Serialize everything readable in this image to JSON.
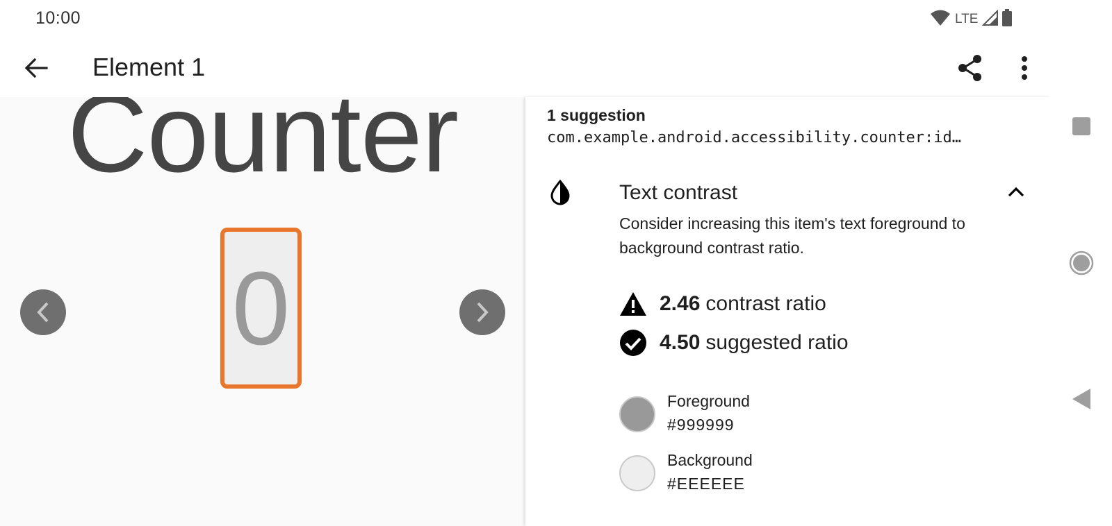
{
  "status_bar": {
    "time": "10:00",
    "network": "LTE",
    "icons": [
      "wifi-icon",
      "cell-signal-icon",
      "battery-icon"
    ]
  },
  "app_bar": {
    "title": "Element 1",
    "icons": [
      "back-arrow-icon",
      "share-icon",
      "more-vert-icon"
    ]
  },
  "screenshot": {
    "app_title": "Counter",
    "counter_value": "0",
    "highlight_color": "#E8762D",
    "buttons": [
      "chevron-left-icon",
      "chevron-right-icon"
    ]
  },
  "panel": {
    "suggestion_count": "1 suggestion",
    "element_id": "com.example.android.accessibility.counter:id…",
    "check": {
      "icon": "contrast-icon",
      "title": "Text contrast",
      "description": "Consider increasing this item's text foreground to background contrast ratio.",
      "collapse_icon": "chevron-up-icon"
    },
    "metrics": [
      {
        "icon": "warning-icon",
        "value": "2.46",
        "label": "contrast ratio"
      },
      {
        "icon": "check-circle-icon",
        "value": "4.50",
        "label": "suggested ratio"
      }
    ],
    "colors": [
      {
        "label": "Foreground",
        "hex": "#999999"
      },
      {
        "label": "Background",
        "hex": "#EEEEEE"
      }
    ]
  },
  "system_nav": {
    "icons": [
      "recents-icon",
      "home-icon",
      "back-triangle-icon"
    ]
  }
}
